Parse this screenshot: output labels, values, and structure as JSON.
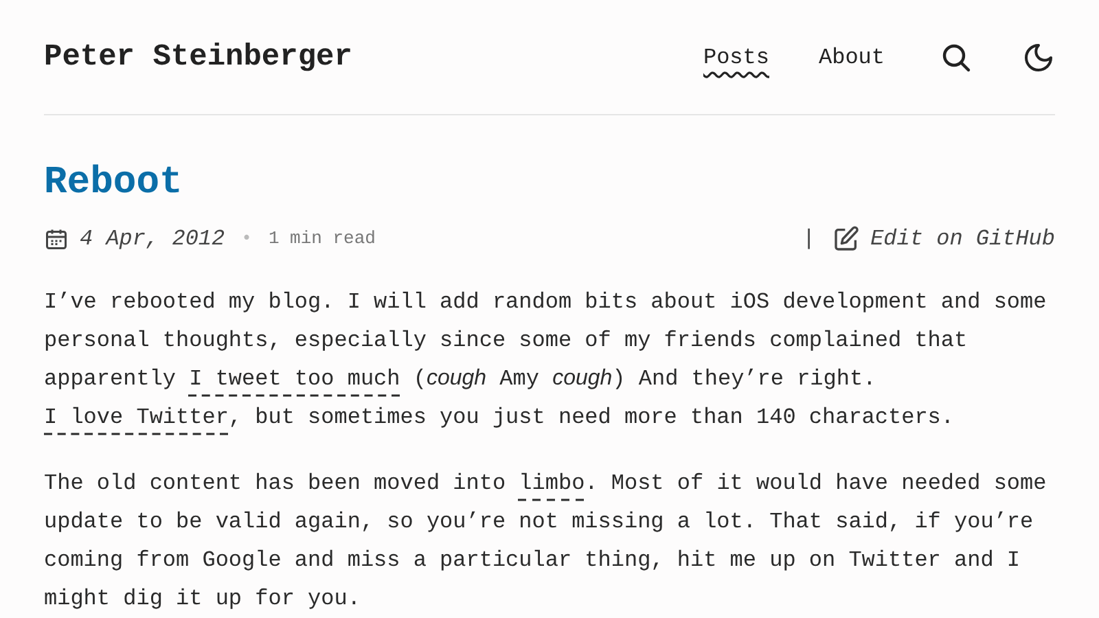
{
  "site_title": "Peter Steinberger",
  "nav": [
    {
      "label": "Posts",
      "selected": true
    },
    {
      "label": "About",
      "selected": false
    }
  ],
  "post": {
    "title": "Reboot",
    "date": "4 Apr, 2012",
    "separator": "•",
    "reading_time": "1 min read",
    "divider": "|",
    "edit_link": "Edit on GitHub",
    "paragraphs": [
      [
        {
          "kind": "plain",
          "text": "I’ve rebooted my blog. I will add random bits about iOS development and some personal thoughts, especially since some of my friends complained that apparently "
        },
        {
          "kind": "link",
          "text": "I tweet too much"
        },
        {
          "kind": "plain",
          "text": " ("
        },
        {
          "kind": "italic",
          "text": "cough"
        },
        {
          "kind": "plain",
          "text": " Amy "
        },
        {
          "kind": "italic",
          "text": "cough"
        },
        {
          "kind": "plain",
          "text": ") And they’re right. "
        },
        {
          "kind": "link",
          "text": "I love Twitter"
        },
        {
          "kind": "plain",
          "text": ", but sometimes you just need more than 140 characters."
        }
      ],
      [
        {
          "kind": "plain",
          "text": "The old content has been moved into "
        },
        {
          "kind": "link",
          "text": "limbo"
        },
        {
          "kind": "plain",
          "text": ". Most of it would have needed some update to be valid again, so you’re not missing a lot. That said, if you’re coming from Google and miss a particular thing, hit me up on Twitter and I might dig it up for you."
        }
      ]
    ]
  }
}
